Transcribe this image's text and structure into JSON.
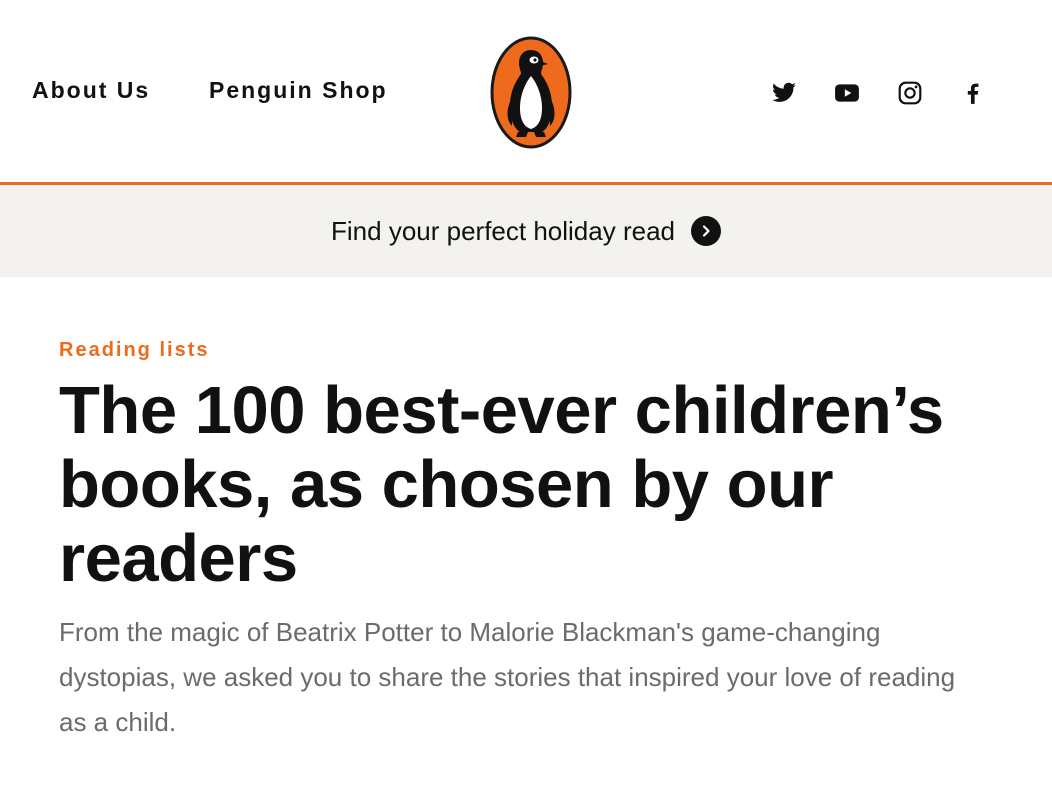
{
  "header": {
    "nav": [
      {
        "label": "About Us"
      },
      {
        "label": "Penguin Shop"
      }
    ],
    "logo_icon": "penguin-logo-icon",
    "social": [
      {
        "icon": "twitter-icon"
      },
      {
        "icon": "youtube-icon"
      },
      {
        "icon": "instagram-icon"
      },
      {
        "icon": "facebook-icon"
      }
    ]
  },
  "promo": {
    "text": "Find your perfect holiday read",
    "icon": "chevron-right-icon"
  },
  "article": {
    "kicker": "Reading lists",
    "title": "The 100 best-ever children’s books, as chosen by our readers",
    "intro": "From the magic of Beatrix Potter to Malorie Blackman's game-changing dystopias, we asked you to share the stories that inspired your love of reading as a child."
  },
  "colors": {
    "accent": "#ee6a1d",
    "promo_background": "#f3f2ee",
    "text": "#111111",
    "muted_text": "#6b6b6b"
  }
}
